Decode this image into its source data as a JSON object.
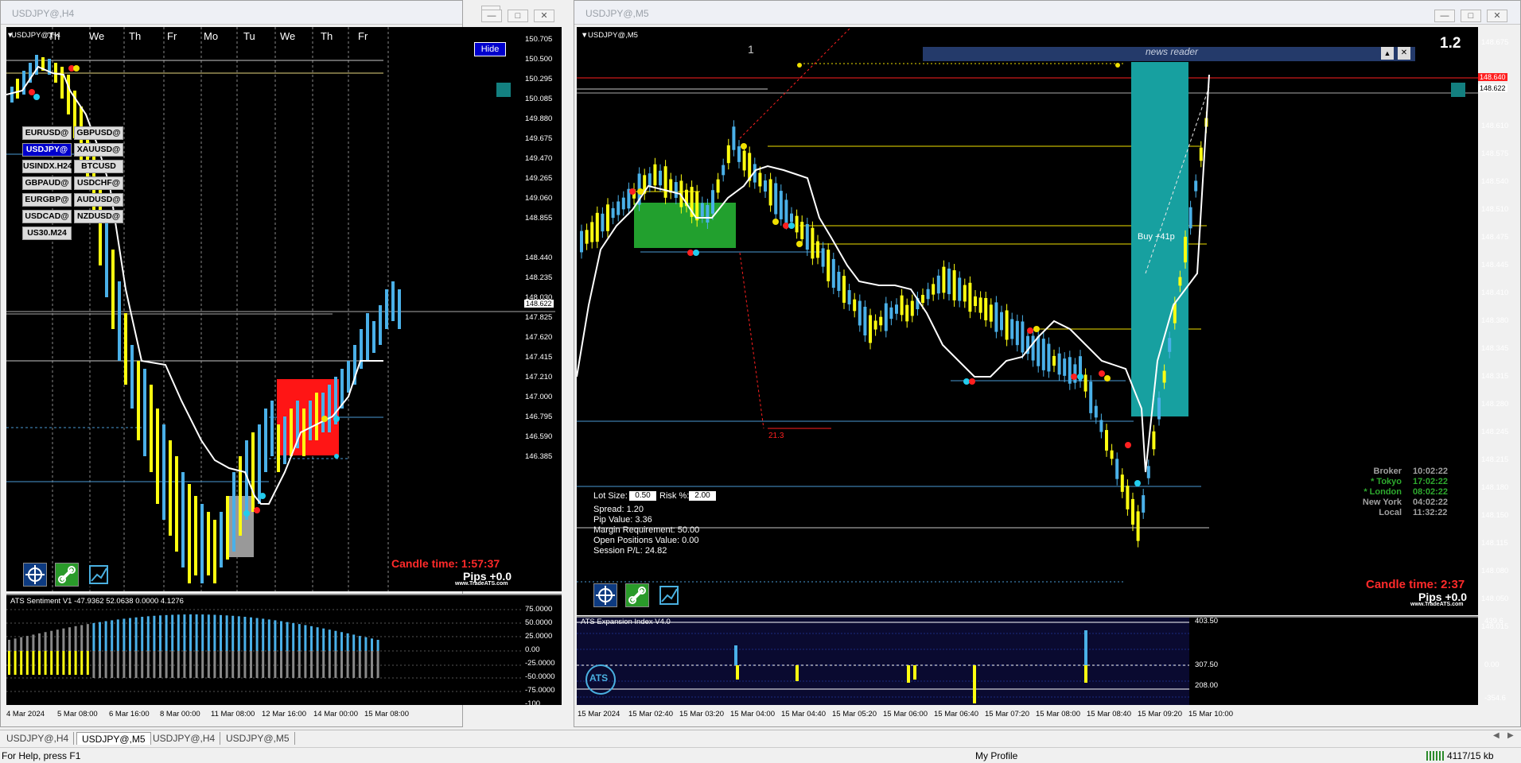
{
  "left_window": {
    "title": "USDJPY@,H4",
    "chart_label": "USDJPY@,H4",
    "hide_button": "Hide",
    "day_labels": [
      "Th",
      "We",
      "Th",
      "Fr",
      "Mo",
      "Tu",
      "We",
      "Th",
      "Fr"
    ],
    "price_axis": [
      "150.705",
      "150.500",
      "150.295",
      "150.085",
      "149.880",
      "149.675",
      "149.470",
      "149.265",
      "149.060",
      "148.855",
      "148.622",
      "148.440",
      "148.235",
      "148.030",
      "147.825",
      "147.620",
      "147.415",
      "147.210",
      "147.000",
      "146.795",
      "146.590",
      "146.385"
    ],
    "current_price": "148.622",
    "symbols": [
      {
        "label": "EURUSD@",
        "active": false
      },
      {
        "label": "GBPUSD@",
        "active": false
      },
      {
        "label": "USDJPY@",
        "active": true
      },
      {
        "label": "XAUUSD@",
        "active": false
      },
      {
        "label": "USINDX.H24",
        "active": false
      },
      {
        "label": "BTCUSD",
        "active": false
      },
      {
        "label": "GBPAUD@",
        "active": false
      },
      {
        "label": "USDCHF@",
        "active": false
      },
      {
        "label": "EURGBP@",
        "active": false
      },
      {
        "label": "AUDUSD@",
        "active": false
      },
      {
        "label": "USDCAD@",
        "active": false
      },
      {
        "label": "NZDUSD@",
        "active": false
      },
      {
        "label": "US30.M24",
        "active": false
      }
    ],
    "candle_time": "Candle time:  1:57:37",
    "pips": "Pips +0.0",
    "brand": "www.TradeATS.com",
    "indicator": "ATS Sentiment V1 -47.9362 52.0638 0.0000 4.1276",
    "indicator_axis": [
      "75.0000",
      "50.0000",
      "25.0000",
      "0.00",
      "-25.0000",
      "-50.0000",
      "-75.0000",
      "-100"
    ],
    "time_axis": [
      "4 Mar 2024",
      "5 Mar 08:00",
      "6 Mar 16:00",
      "8 Mar 00:00",
      "11 Mar 08:00",
      "12 Mar 16:00",
      "14 Mar 00:00",
      "15 Mar 08:00"
    ]
  },
  "right_window": {
    "title": "USDJPY@,M5",
    "chart_label": "USDJPY@,M5",
    "version": "1.2",
    "marker_1": "1",
    "news_reader": "news reader",
    "price_axis": [
      "148.675",
      "148.640",
      "148.622",
      "148.610",
      "148.575",
      "148.540",
      "148.510",
      "148.475",
      "148.445",
      "148.410",
      "148.380",
      "148.345",
      "148.315",
      "148.280",
      "148.245",
      "148.215",
      "148.180",
      "148.150",
      "148.115",
      "148.080",
      "148.050",
      "148.015"
    ],
    "red_tag": "148.640",
    "current_price": "148.622",
    "buy_label": "Buy +41p",
    "fib_label": "21.3",
    "lot_size_label": "Lot Size:",
    "lot_size_value": "0.50",
    "risk_label": "Risk %:",
    "risk_value": "2.00",
    "spread": "Spread: 1.20",
    "pip_value": "Pip Value: 3.36",
    "margin": "Margin Requirement: 50.00",
    "open_positions": "Open Positions Value: 0.00",
    "session_pl": "Session P/L: 24.82",
    "clocks": [
      {
        "label": "Broker",
        "time": "10:02:22",
        "color": "#a0a0a0"
      },
      {
        "label": "* Tokyo",
        "time": "17:02:22",
        "color": "#2eaa2e"
      },
      {
        "label": "* London",
        "time": "08:02:22",
        "color": "#2eaa2e"
      },
      {
        "label": "New York",
        "time": "04:02:22",
        "color": "#a0a0a0"
      },
      {
        "label": "Local",
        "time": "11:32:22",
        "color": "#a0a0a0"
      }
    ],
    "candle_time": "Candle time:  2:37",
    "pips": "Pips +0.0",
    "brand": "www.TradeATS.com",
    "indicator": "ATS Expansion Index V4.0",
    "indicator_levels": [
      "403.50",
      "307.50",
      "208.00"
    ],
    "indicator_axis": [
      "439.6",
      "0.00",
      "-354.6"
    ],
    "ats_logo": "ATS",
    "time_axis": [
      "15 Mar 2024",
      "15 Mar 02:40",
      "15 Mar 03:20",
      "15 Mar 04:00",
      "15 Mar 04:40",
      "15 Mar 05:20",
      "15 Mar 06:00",
      "15 Mar 06:40",
      "15 Mar 07:20",
      "15 Mar 08:00",
      "15 Mar 08:40",
      "15 Mar 09:20",
      "15 Mar 10:00"
    ]
  },
  "tabs": [
    "USDJPY@,H4",
    "USDJPY@,M5",
    "USDJPY@,H4",
    "USDJPY@,M5"
  ],
  "active_tab": 1,
  "status": {
    "help": "For Help, press F1",
    "profile": "My Profile",
    "traffic": "4117/15 kb"
  }
}
